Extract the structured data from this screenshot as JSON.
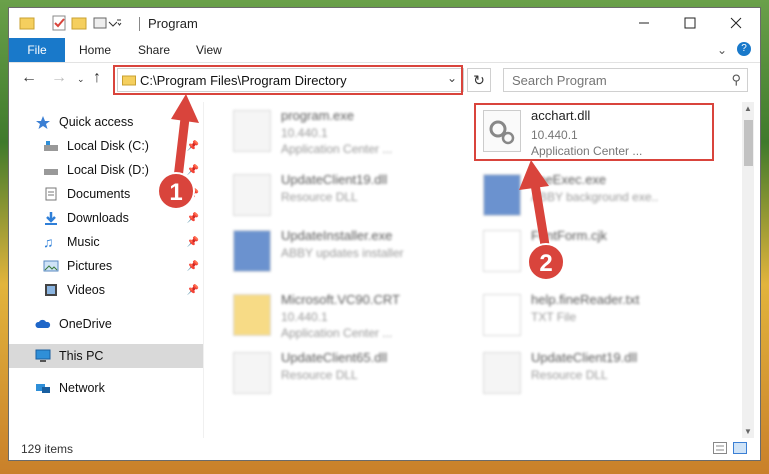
{
  "window": {
    "title": "Program"
  },
  "ribbon": {
    "tabs": [
      "File",
      "Home",
      "Share",
      "View"
    ]
  },
  "address": {
    "path": "C:\\Program Files\\Program Directory"
  },
  "search": {
    "placeholder": "Search Program"
  },
  "sidebar": {
    "items": [
      {
        "label": "Quick access",
        "icon": "star-icon"
      },
      {
        "label": "Local Disk (C:)",
        "icon": "drive-icon"
      },
      {
        "label": "Local Disk (D:)",
        "icon": "drive-icon"
      },
      {
        "label": "Documents",
        "icon": "documents-icon"
      },
      {
        "label": "Downloads",
        "icon": "downloads-icon"
      },
      {
        "label": "Music",
        "icon": "music-icon"
      },
      {
        "label": "Pictures",
        "icon": "pictures-icon"
      },
      {
        "label": "Videos",
        "icon": "videos-icon"
      },
      {
        "label": "OneDrive",
        "icon": "cloud-icon"
      },
      {
        "label": "This PC",
        "icon": "pc-icon"
      },
      {
        "label": "Network",
        "icon": "network-icon"
      }
    ]
  },
  "files": [
    {
      "name": "program.exe",
      "line1": "10.440.1",
      "line2": "Application Center ..."
    },
    {
      "name": "acchart.dll",
      "line1": "10.440.1",
      "line2": "Application Center ..."
    },
    {
      "name": "UpdateClient19.dll",
      "line1": "Resource DLL",
      "line2": ""
    },
    {
      "name": "..neExec.exe",
      "line1": "ABBY background exe..",
      "line2": ""
    },
    {
      "name": "UpdateInstaller.exe",
      "line1": "ABBY updates installer",
      "line2": ""
    },
    {
      "name": "FontForm.cjk",
      "line1": "",
      "line2": ""
    },
    {
      "name": "Microsoft.VC90.CRT",
      "line1": "10.440.1",
      "line2": "Application Center ..."
    },
    {
      "name": "help.fineReader.txt",
      "line1": "TXT File",
      "line2": ""
    },
    {
      "name": "UpdateClient65.dll",
      "line1": "Resource DLL",
      "line2": ""
    },
    {
      "name": "UpdateClient19.dll",
      "line1": "Resource DLL",
      "line2": ""
    }
  ],
  "status": {
    "count": "129 items"
  },
  "annotations": {
    "step1": "1",
    "step2": "2",
    "color": "#d9443c"
  }
}
